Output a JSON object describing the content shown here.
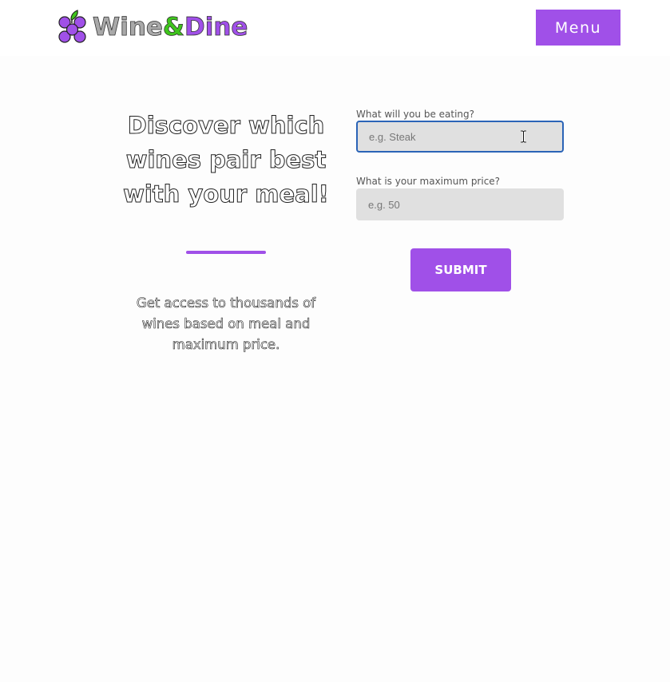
{
  "header": {
    "logo": {
      "part1": "Wine",
      "part2": "&",
      "part3": "Dine",
      "icon": "grapes-icon",
      "colors": {
        "wine": "#a9a9a9",
        "ampersand": "#3fc51c",
        "dine": "#a050e8",
        "grapes": "#a050e8",
        "leaf": "#3fc51c"
      }
    },
    "menu_label": "Menu"
  },
  "hero": {
    "headline_line1": "Discover which",
    "headline_line2": "wines pair best",
    "headline_line3": "with your meal!",
    "subtext_line1": "Get access to thousands of",
    "subtext_line2": "wines based on meal and",
    "subtext_line3": "maximum price."
  },
  "form": {
    "food_label": "What will you be eating?",
    "food_placeholder": "e.g. Steak",
    "food_value": "",
    "price_label": "What is your maximum price?",
    "price_placeholder": "e.g. 50",
    "price_value": "",
    "submit_label": "SUBMIT"
  },
  "theme": {
    "accent": "#a050e8",
    "focus_border": "#2b64b7",
    "input_bg": "#e0e0e0"
  }
}
